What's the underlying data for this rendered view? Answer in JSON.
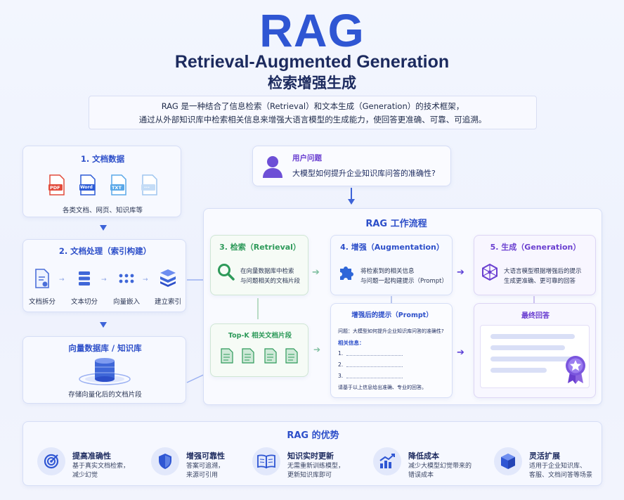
{
  "header": {
    "title": "RAG",
    "subtitle_en": "Retrieval-Augmented Generation",
    "subtitle_zh": "检索增强生成",
    "intro_line1": "RAG 是一种结合了信息检索（Retrieval）和文本生成（Generation）的技术框架，",
    "intro_line2": "通过从外部知识库中检索相关信息来增强大语言模型的生成能力，使回答更准确、可靠、可追溯。"
  },
  "doc_data": {
    "title": "1. 文档数据",
    "file_labels": [
      "PDF",
      "Word",
      "TXT",
      "..."
    ],
    "caption": "各类文档、网页、知识库等"
  },
  "doc_process": {
    "title": "2. 文档处理（索引构建）",
    "steps": [
      "文档拆分",
      "文本切分",
      "向量嵌入",
      "建立索引"
    ]
  },
  "vector_db": {
    "title": "向量数据库 / 知识库",
    "caption": "存储向量化后的文档片段"
  },
  "user_question": {
    "label": "用户问题",
    "text": "大模型如何提升企业知识库问答的准确性?"
  },
  "workflow": {
    "title": "RAG 工作流程",
    "retrieval": {
      "title": "3. 检索（Retrieval）",
      "line1": "在向量数据库中检索",
      "line2": "与问题相关的文档片段"
    },
    "augmentation": {
      "title": "4. 增强（Augmentation）",
      "line1": "将检索到的相关信息",
      "line2": "与问题一起构建提示（Prompt）"
    },
    "generation": {
      "title": "5. 生成（Generation）",
      "line1": "大语言模型根据增强后的提示",
      "line2": "生成更准确、更可靠的回答"
    },
    "topk": {
      "title": "Top-K 相关文档片段"
    },
    "prompt": {
      "title": "增强后的提示（Prompt）",
      "question": "问题：大模型如何提升企业知识库问答的准确性?",
      "info_label": "相关信息：",
      "items": [
        "1.",
        "2.",
        "3."
      ],
      "footer": "请基于以上信息给出准确、专业的回答。"
    },
    "final": {
      "title": "最终回答"
    }
  },
  "advantages": {
    "title": "RAG 的优势",
    "items": [
      {
        "icon": "target-icon",
        "title": "提高准确性",
        "desc1": "基于真实文档检索，",
        "desc2": "减少幻觉"
      },
      {
        "icon": "shield-icon",
        "title": "增强可靠性",
        "desc1": "答案可追溯，",
        "desc2": "来源可引用"
      },
      {
        "icon": "book-icon",
        "title": "知识实时更新",
        "desc1": "无需重新训练模型，",
        "desc2": "更新知识库即可"
      },
      {
        "icon": "chart-icon",
        "title": "降低成本",
        "desc1": "减少大模型幻觉带来的",
        "desc2": "错误成本"
      },
      {
        "icon": "cube-icon",
        "title": "灵活扩展",
        "desc1": "适用于企业知识库、",
        "desc2": "客服、文档问答等场景"
      }
    ]
  },
  "colors": {
    "primary": "#2f56d3",
    "green": "#2e9a5a",
    "purple": "#6a3fd0",
    "navy": "#1c2a5e"
  }
}
